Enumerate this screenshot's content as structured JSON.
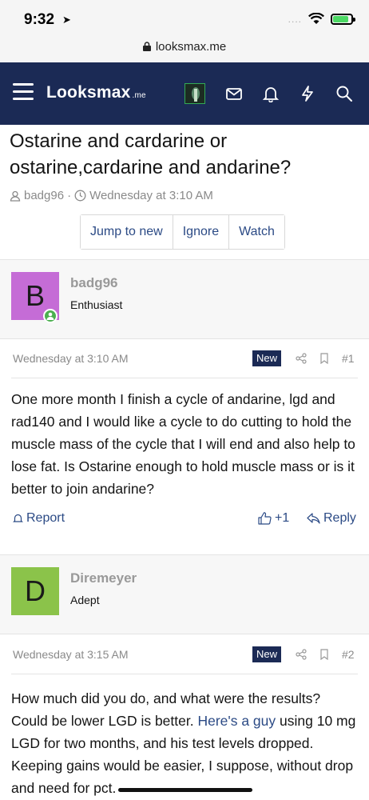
{
  "status": {
    "time": "9:32",
    "signal": "....",
    "battery_level": 0.85
  },
  "browser": {
    "url": "looksmax.me"
  },
  "header": {
    "logo_main": "Looksmax",
    "logo_suffix": ".me"
  },
  "thread": {
    "title": "Ostarine and cardarine or ostarine,cardarine and andarine?",
    "author": "badg96",
    "meta_sep": "·",
    "date": "Wednesday at 3:10 AM",
    "actions": [
      "Jump to new",
      "Ignore",
      "Watch"
    ]
  },
  "posts": [
    {
      "avatar_letter": "B",
      "avatar_color": "#c56cd6",
      "username": "badg96",
      "user_title": "Enthusiast",
      "time": "Wednesday at 3:10 AM",
      "badge": "New",
      "number": "#1",
      "body": "One more month I finish a cycle of andarine, lgd and rad140 and I would like a cycle to do cutting to hold the muscle mass of the cycle that I will end and also help to lose fat. Is Ostarine enough to hold muscle mass or is it better to join andarine?",
      "report_label": "Report",
      "reaction_count": "+1",
      "reply_label": "Reply"
    },
    {
      "avatar_letter": "D",
      "avatar_color": "#8bc34a",
      "username": "Diremeyer",
      "user_title": "Adept",
      "time": "Wednesday at 3:15 AM",
      "badge": "New",
      "number": "#2",
      "body_pre": "How much did you do, and what were the results? Could be lower LGD is better. ",
      "body_link": "Here's a guy",
      "body_post": " using 10 mg LGD for two months, and his test levels dropped. Keeping gains would be easier, I suppose, without drop and need for pct."
    }
  ]
}
